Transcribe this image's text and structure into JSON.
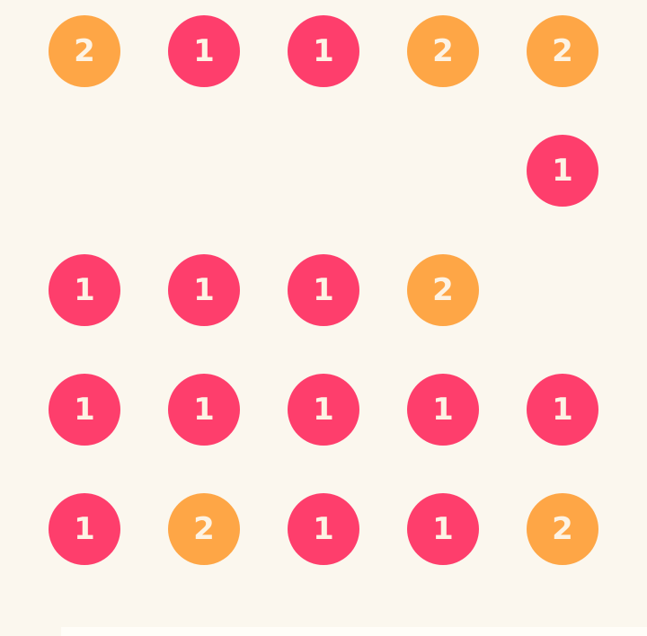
{
  "colors": {
    "background": "#fbf7ee",
    "text": "#fdf3e4",
    "value_1": "#fe3e6c",
    "value_2": "#fea646"
  },
  "board": {
    "columns": 5,
    "rows": [
      [
        "2",
        "1",
        "1",
        "2",
        "2"
      ],
      [
        "",
        "",
        "",
        "",
        "1"
      ],
      [
        "1",
        "1",
        "1",
        "2",
        ""
      ],
      [
        "1",
        "1",
        "1",
        "1",
        "1"
      ],
      [
        "1",
        "2",
        "1",
        "1",
        "2"
      ]
    ]
  }
}
